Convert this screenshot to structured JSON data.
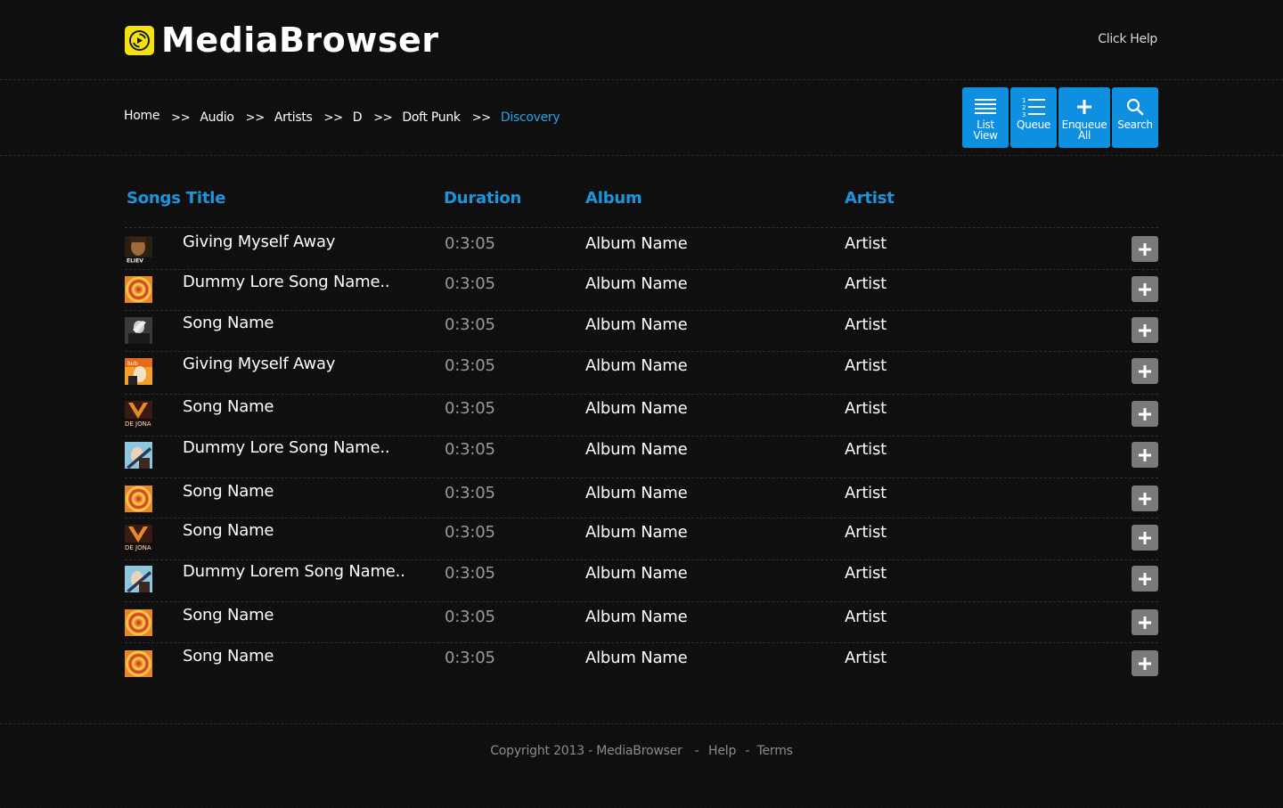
{
  "header": {
    "logo_text": "MediaBrowser",
    "help_link": "Click Help"
  },
  "breadcrumb": {
    "items": [
      "Home",
      "Audio",
      "Artists",
      "D",
      "Doft Punk",
      "Discovery"
    ],
    "separator": ">>"
  },
  "toolbar": {
    "list_view": [
      "List",
      "View"
    ],
    "queue": "Queue",
    "enqueue_all": [
      "Enqueue",
      "All"
    ],
    "search": "Search"
  },
  "columns": {
    "title": "Songs Title",
    "duration": "Duration",
    "album": "Album",
    "artist": "Artist"
  },
  "rows": [
    {
      "title": "Giving Myself Away",
      "duration": "0:3:05",
      "album": "Album Name",
      "artist": "Artist",
      "thumb": "portrait"
    },
    {
      "title": "Dummy Lore Song Name..",
      "duration": "0:3:05",
      "album": "Album Name",
      "artist": "Artist",
      "thumb": "spiral"
    },
    {
      "title": "Song Name",
      "duration": "0:3:05",
      "album": "Album Name",
      "artist": "Artist",
      "thumb": "bw"
    },
    {
      "title": "Giving Myself Away",
      "duration": "0:3:05",
      "album": "Album Name",
      "artist": "Artist",
      "thumb": "orange"
    },
    {
      "title": "Song Name",
      "duration": "0:3:05",
      "album": "Album Name",
      "artist": "Artist",
      "thumb": "jonas"
    },
    {
      "title": "Dummy Lore Song Name..",
      "duration": "0:3:05",
      "album": "Album Name",
      "artist": "Artist",
      "thumb": "guitar"
    },
    {
      "title": "Song Name",
      "duration": "0:3:05",
      "album": "Album Name",
      "artist": "Artist",
      "thumb": "spiral"
    },
    {
      "title": "Song Name",
      "duration": "0:3:05",
      "album": "Album Name",
      "artist": "Artist",
      "thumb": "jonas"
    },
    {
      "title": "Dummy Lorem Song Name..",
      "duration": "0:3:05",
      "album": "Album Name",
      "artist": "Artist",
      "thumb": "guitar"
    },
    {
      "title": "Song Name",
      "duration": "0:3:05",
      "album": "Album Name",
      "artist": "Artist",
      "thumb": "spiral"
    },
    {
      "title": "Song Name",
      "duration": "0:3:05",
      "album": "Album Name",
      "artist": "Artist",
      "thumb": "spiral"
    }
  ],
  "thumb_text": {
    "portrait": "ELIEV",
    "jonas": "DE JONA",
    "orange": "bub"
  },
  "footer": {
    "copyright": "Copyright 2013 - MediaBrowser",
    "help": "Help",
    "terms": "Terms"
  },
  "colors": {
    "accent": "#1b96dd",
    "toolbar_bg": "#0f8fe0",
    "logo_bg": "#f4e20f",
    "add_btn": "#7a7a7a"
  }
}
